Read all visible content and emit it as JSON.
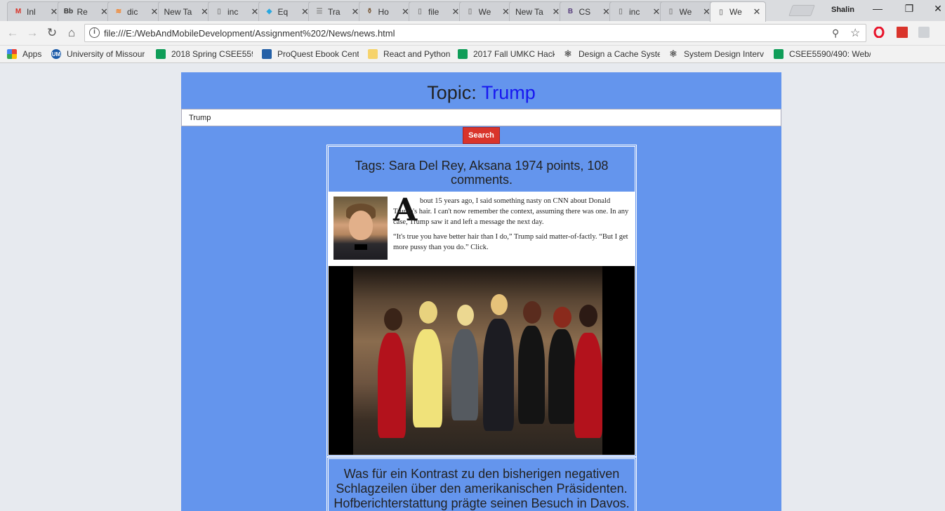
{
  "browser": {
    "tabs": [
      {
        "title": "Inl",
        "icon": "gmail-icon",
        "icon_color": "#d93025",
        "icon_glyph": "M"
      },
      {
        "title": "Re",
        "icon": "blackboard-icon",
        "icon_color": "#333333",
        "icon_glyph": "Bb"
      },
      {
        "title": "dic",
        "icon": "stackoverflow-icon",
        "icon_color": "#f48024",
        "icon_glyph": "≋"
      },
      {
        "title": "New Ta",
        "icon": "",
        "icon_color": "",
        "icon_glyph": ""
      },
      {
        "title": "inc",
        "icon": "file-icon",
        "icon_color": "#888888",
        "icon_glyph": "▯"
      },
      {
        "title": "Eq",
        "icon": "graduation-icon",
        "icon_color": "#29a8e0",
        "icon_glyph": "◆"
      },
      {
        "title": "Tra",
        "icon": "list-icon",
        "icon_color": "#888888",
        "icon_glyph": "☰"
      },
      {
        "title": "Ho",
        "icon": "jar-icon",
        "icon_color": "#7a5a3a",
        "icon_glyph": "⚱"
      },
      {
        "title": "file",
        "icon": "file-icon",
        "icon_color": "#888888",
        "icon_glyph": "▯"
      },
      {
        "title": "We",
        "icon": "file-icon",
        "icon_color": "#888888",
        "icon_glyph": "▯"
      },
      {
        "title": "New Ta",
        "icon": "",
        "icon_color": "",
        "icon_glyph": ""
      },
      {
        "title": "CS",
        "icon": "bootstrap-icon",
        "icon_color": "#563d7c",
        "icon_glyph": "B"
      },
      {
        "title": "inc",
        "icon": "file-icon",
        "icon_color": "#888888",
        "icon_glyph": "▯"
      },
      {
        "title": "We",
        "icon": "file-icon",
        "icon_color": "#888888",
        "icon_glyph": "▯"
      },
      {
        "title": "We",
        "icon": "file-icon",
        "icon_color": "#888888",
        "icon_glyph": "▯",
        "active": true
      }
    ],
    "profile_name": "Shalin",
    "url": "file:///E:/WebAndMobileDevelopment/Assignment%202/News/news.html",
    "bookmarks": [
      {
        "label": "Apps",
        "icon": "apps-grid-icon",
        "color": "#e94235"
      },
      {
        "label": "University of Missour",
        "icon": "university-icon",
        "color": "#1a5aa8"
      },
      {
        "label": "2018 Spring CSEE559",
        "icon": "sheets-icon",
        "color": "#0f9d58"
      },
      {
        "label": "ProQuest Ebook Cent",
        "icon": "proquest-icon",
        "color": "#2460a7"
      },
      {
        "label": "React and Python",
        "icon": "folder-icon",
        "color": "#f6d36b"
      },
      {
        "label": "2017 Fall UMKC Hack",
        "icon": "sheets-icon",
        "color": "#0f9d58"
      },
      {
        "label": "Design a Cache Syste",
        "icon": "leetcode-icon",
        "color": "#555555"
      },
      {
        "label": "System Design Interv",
        "icon": "leetcode-icon",
        "color": "#555555"
      },
      {
        "label": "CSEE5590/490: Web/(",
        "icon": "sheets-icon",
        "color": "#0f9d58"
      }
    ]
  },
  "page": {
    "topic_label": "Topic:",
    "topic_value": "Trump",
    "search_value": "Trump",
    "search_button": "Search",
    "articles": [
      {
        "tags_text": "Tags: Sara Del Rey, Aksana 1974 points, 108 comments.",
        "clip_dropcap": "A",
        "clip_para1": "bout 15 years ago, I said something nasty on CNN about Donald Trump's hair. I can't now remember the context, assuming there was one. In any case, Trump saw it and left a message the next day.",
        "clip_para2": "“It's true you have better hair than I do,” Trump said matter-of-factly. “But I get more pussy than you do.” Click."
      },
      {
        "text": "Was für ein Kontrast zu den bisherigen negativen Schlagzeilen über den amerikanischen Präsidenten. Hofberichterstattung prägte seinen Besuch in Davos."
      }
    ]
  },
  "colors": {
    "panel": "#6495ed",
    "topic_value": "#1818f0",
    "search_button": "#d9342b"
  }
}
